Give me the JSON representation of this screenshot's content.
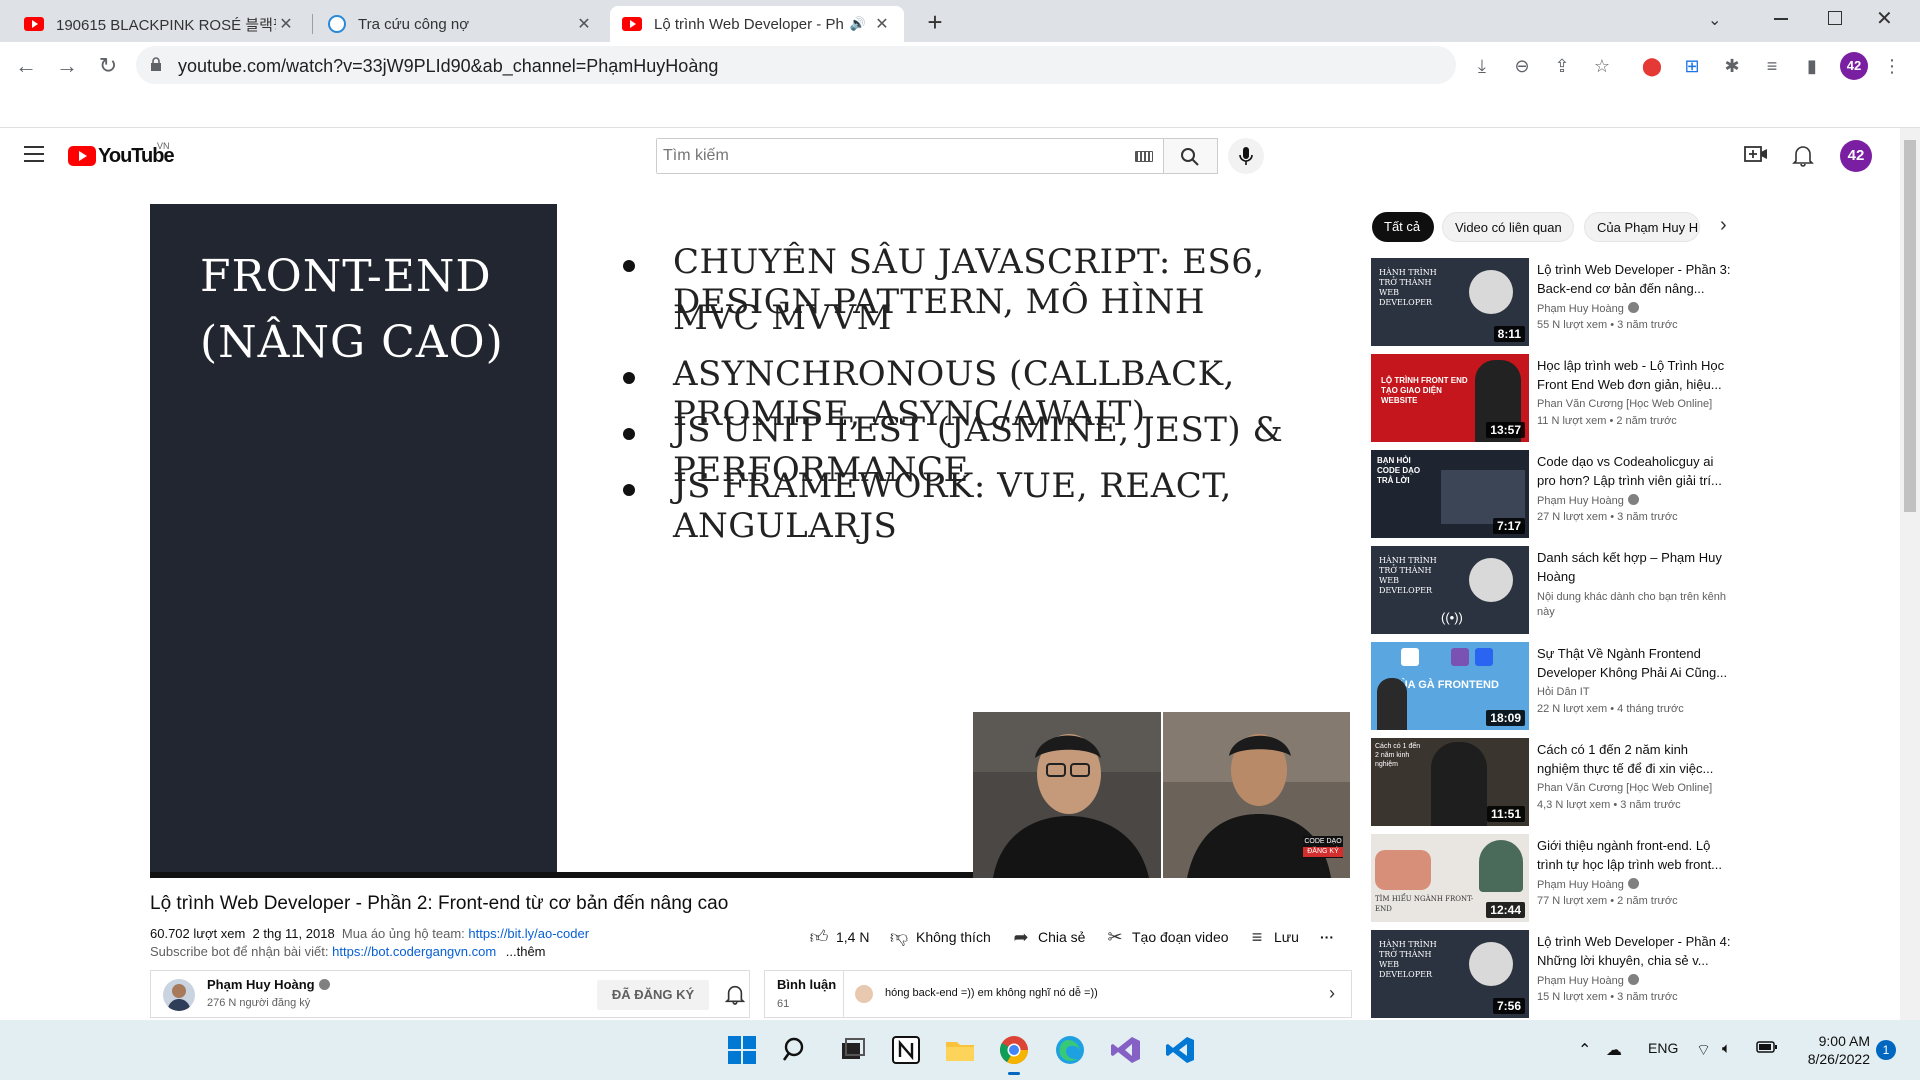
{
  "browser": {
    "tabs": [
      {
        "title": "190615 BLACKPINK ROSÉ 블랙핑",
        "active": false
      },
      {
        "title": "Tra cứu công nợ",
        "active": false
      },
      {
        "title": "Lộ trình Web Developer - Ph",
        "active": true
      }
    ],
    "new_tab": "+",
    "url": "youtube.com/watch?v=33jW9PLId90&ab_channel=PhạmHuyHoàng",
    "profile_badge": "42"
  },
  "youtube": {
    "logo_text": "YouTube",
    "region": "VN",
    "search_placeholder": "Tìm kiếm",
    "profile_badge": "42"
  },
  "slide": {
    "title_line1": "FRONT-END",
    "title_line2": "(NÂNG CAO)",
    "bullets": [
      "CHUYÊN SÂU JAVASCRIPT: ES6, DESIGN PATTERN, MÔ HÌNH",
      "MVC MVVM",
      "ASYNCHRONOUS (CALLBACK, PROMISE, ASYNC/AWAIT)",
      "JS UNIT TEST (JASMINE, JEST) & PERFORMANCE",
      "JS FRAMEWORK: VUE, REACT, ANGULARJS"
    ],
    "cam_badge_line1": "CODE DẠO",
    "cam_badge_line2": "ĐĂNG KÝ"
  },
  "video": {
    "title": "Lộ trình Web Developer - Phần 2: Front-end từ cơ bản đến nâng cao",
    "views": "60.702 lượt xem",
    "date": "2 thg 11, 2018",
    "desc1_prefix": "Mua áo ủng hộ team:",
    "desc1_link": "https://bit.ly/ao-coder",
    "desc2_prefix": "Subscribe bot để nhận bài viết:",
    "desc2_link": "https://bot.codergangvn.com",
    "more": "...thêm",
    "actions": {
      "like": "1,4 N",
      "dislike": "Không thích",
      "share": "Chia sẻ",
      "clip": "Tạo đoạn video",
      "save": "Lưu",
      "more": "···"
    },
    "channel": {
      "name": "Phạm Huy Hoàng",
      "subs": "276 N người đăng ký",
      "subscribe": "ĐÃ ĐĂNG KÝ"
    },
    "comments": {
      "label": "Bình luận",
      "count": "61",
      "preview": "hóng back-end =)) em không nghĩ nó dễ =))"
    }
  },
  "chips": [
    "Tất cả",
    "Video có liên quan",
    "Của Phạm Huy H"
  ],
  "recommendations": [
    {
      "title": "Lộ trình Web Developer - Phần 3: Back-end cơ bản đến nâng...",
      "channel": "Phạm Huy Hoàng",
      "verified": true,
      "views": "55 N lượt xem • 3 năm trước",
      "duration": "8:11",
      "thumb_color": "#2b3240",
      "thumb_text": "HÀNH TRÌNH TRỞ THÀNH WEB DEVELOPER"
    },
    {
      "title": "Học lập trình web - Lộ Trình Học Front End Web đơn giản, hiệu...",
      "channel": "Phan Văn Cương [Học Web Online]",
      "verified": false,
      "views": "11 N lượt xem • 2 năm trước",
      "duration": "13:57",
      "thumb_color": "#c4161c",
      "thumb_text": "LỘ TRÌNH FRONT END TẠO GIAO DIỆN WEBSITE"
    },
    {
      "title": "Code dạo vs Codeaholicguy ai pro hơn? Lập trình viên giải trí...",
      "channel": "Phạm Huy Hoàng",
      "verified": true,
      "views": "27 N lượt xem • 3 năm trước",
      "duration": "7:17",
      "thumb_color": "#1e2430",
      "thumb_text": "BẠN HỎI CODE DẠO TRẢ LỜI"
    },
    {
      "title": "Danh sách kết hợp – Phạm Huy Hoàng",
      "channel": "Nội dung khác dành cho bạn trên kênh này",
      "verified": false,
      "views": "",
      "duration": "",
      "thumb_color": "#2b3240",
      "thumb_text": "HÀNH TRÌNH TRỞ THÀNH WEB DEVELOPER"
    },
    {
      "title": "Sự Thật Về Ngành Frontend Developer Không Phải Ai Cũng...",
      "channel": "Hỏi Dân IT",
      "verified": false,
      "views": "22 N lượt xem • 4 tháng trước",
      "duration": "18:09",
      "thumb_color": "#5aa6e0",
      "thumb_text": "LÙA GÀ FRONTEND"
    },
    {
      "title": "Cách có 1 đến 2 năm kinh nghiệm thực tế để đi xin việc...",
      "channel": "Phan Văn Cương [Học Web Online]",
      "verified": false,
      "views": "4,3 N lượt xem • 3 năm trước",
      "duration": "11:51",
      "thumb_color": "#3b3530",
      "thumb_text": "Cách có 1 đến 2 năm kinh nghiệm"
    },
    {
      "title": "Giới thiệu ngành front-end. Lộ trình tự học lập trình web front...",
      "channel": "Phạm Huy Hoàng",
      "verified": true,
      "views": "77 N lượt xem • 2 năm trước",
      "duration": "12:44",
      "thumb_color": "#e9e6e2",
      "thumb_text": "TÌM HIỂU NGÀNH FRONT-END"
    },
    {
      "title": "Lộ trình Web Developer - Phần 4: Những lời khuyên, chia sẻ v...",
      "channel": "Phạm Huy Hoàng",
      "verified": true,
      "views": "15 N lượt xem • 3 năm trước",
      "duration": "7:56",
      "thumb_color": "#2b3240",
      "thumb_text": "HÀNH TRÌNH TRỞ THÀNH WEB DEVELOPER"
    }
  ],
  "taskbar": {
    "lang": "ENG",
    "time": "9:00 AM",
    "date": "8/26/2022",
    "notifications": "1"
  }
}
